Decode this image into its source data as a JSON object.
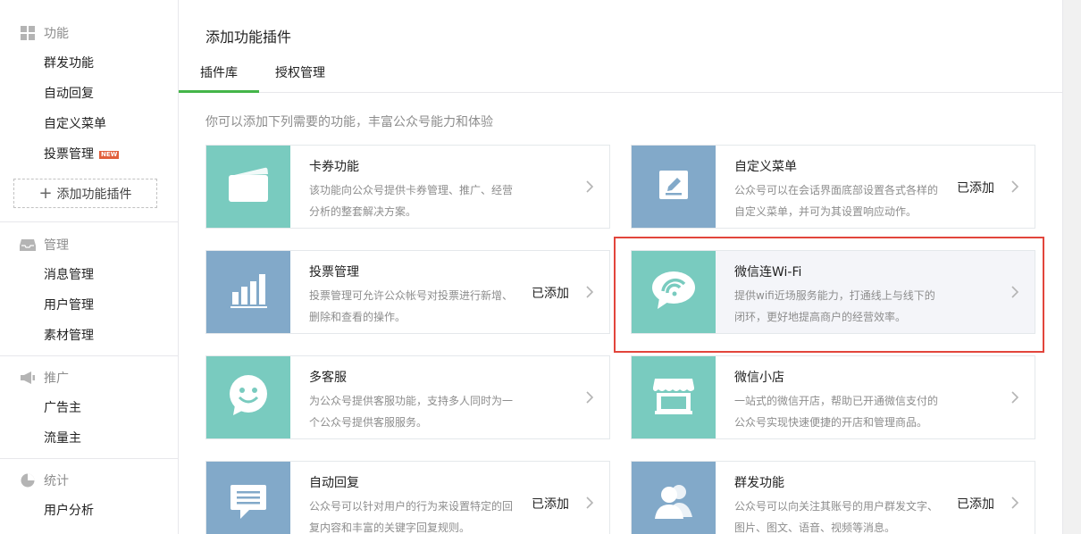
{
  "sidebar": {
    "sections": [
      {
        "title": "功能",
        "icon": "grid-icon",
        "items": [
          {
            "label": "群发功能"
          },
          {
            "label": "自动回复"
          },
          {
            "label": "自定义菜单"
          },
          {
            "label": "投票管理",
            "badge": "NEW"
          }
        ]
      },
      {
        "title": "管理",
        "icon": "inbox-icon",
        "items": [
          {
            "label": "消息管理"
          },
          {
            "label": "用户管理"
          },
          {
            "label": "素材管理"
          }
        ]
      },
      {
        "title": "推广",
        "icon": "megaphone-icon",
        "items": [
          {
            "label": "广告主"
          },
          {
            "label": "流量主"
          }
        ]
      },
      {
        "title": "统计",
        "icon": "pie-chart-icon",
        "items": [
          {
            "label": "用户分析"
          }
        ]
      }
    ],
    "add_plugin_label": "添加功能插件",
    "add_plugin_plus": "+"
  },
  "main": {
    "title": "添加功能插件",
    "tabs": [
      {
        "label": "插件库",
        "active": true
      },
      {
        "label": "授权管理",
        "active": false
      }
    ],
    "intro": "你可以添加下列需要的功能，丰富公众号能力和体验",
    "cards": [
      {
        "name": "卡券功能",
        "desc": "该功能向公众号提供卡券管理、推广、经营分析的整套解决方案。",
        "status": "",
        "icon": "card-icon",
        "tile_color": "#79cbbf"
      },
      {
        "name": "自定义菜单",
        "desc": "公众号可以在会话界面底部设置各式各样的自定义菜单，并可为其设置响应动作。",
        "status": "已添加",
        "icon": "pencil-icon",
        "tile_color": "#82a9c9"
      },
      {
        "name": "投票管理",
        "desc": "投票管理可允许公众帐号对投票进行新增、删除和查看的操作。",
        "status": "已添加",
        "icon": "bar-chart-icon",
        "tile_color": "#82a9c9"
      },
      {
        "name": "微信连Wi-Fi",
        "desc": "提供wifi近场服务能力，打通线上与线下的闭环，更好地提高商户的经营效率。",
        "status": "",
        "icon": "wifi-bubble-icon",
        "tile_color": "#79cbbf",
        "highlighted": true
      },
      {
        "name": "多客服",
        "desc": "为公众号提供客服功能，支持多人同时为一个公众号提供客服服务。",
        "status": "",
        "icon": "smiley-bubble-icon",
        "tile_color": "#79cbbf"
      },
      {
        "name": "微信小店",
        "desc": "一站式的微信开店，帮助已开通微信支付的公众号实现快速便捷的开店和管理商品。",
        "status": "",
        "icon": "shop-icon",
        "tile_color": "#79cbbf"
      },
      {
        "name": "自动回复",
        "desc": "公众号可以针对用户的行为来设置特定的回复内容和丰富的关键字回复规则。",
        "status": "已添加",
        "icon": "message-icon",
        "tile_color": "#82a9c9"
      },
      {
        "name": "群发功能",
        "desc": "公众号可以向关注其账号的用户群发文字、图片、图文、语音、视频等消息。",
        "status": "已添加",
        "icon": "users-icon",
        "tile_color": "#82a9c9"
      }
    ]
  },
  "colors": {
    "accent": "#44b549",
    "teal_tile": "#79cbbf",
    "blue_tile": "#82a9c9",
    "highlight": "#e2453c",
    "badge": "#e15f3b"
  }
}
